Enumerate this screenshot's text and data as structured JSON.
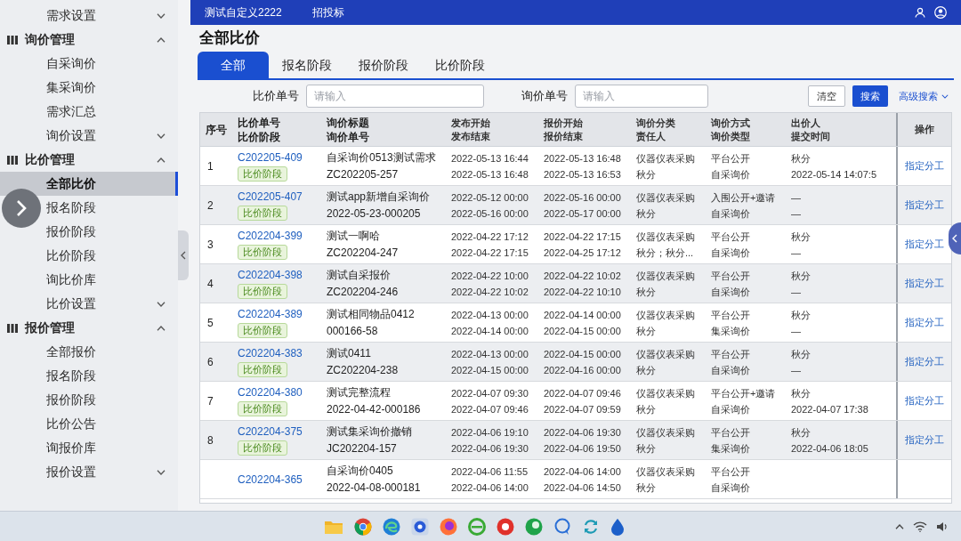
{
  "top_bar": {
    "menu": [
      {
        "label": "测试自定义2222"
      },
      {
        "label": "招投标"
      }
    ]
  },
  "sidebar": {
    "items": [
      {
        "label": "需求设置",
        "kind": "submenu",
        "expanded": false,
        "selected": false
      },
      {
        "label": "询价管理",
        "kind": "group",
        "expanded": true,
        "selected": false,
        "children": [
          {
            "label": "自采询价",
            "kind": "link",
            "selected": false
          },
          {
            "label": "集采询价",
            "kind": "link",
            "selected": false
          },
          {
            "label": "需求汇总",
            "kind": "link",
            "selected": false
          },
          {
            "label": "询价设置",
            "kind": "submenu",
            "expanded": false,
            "selected": false
          }
        ]
      },
      {
        "label": "比价管理",
        "kind": "group",
        "expanded": true,
        "selected": false,
        "children": [
          {
            "label": "全部比价",
            "kind": "link",
            "selected": true
          },
          {
            "label": "报名阶段",
            "kind": "link",
            "selected": false
          },
          {
            "label": "报价阶段",
            "kind": "link",
            "selected": false
          },
          {
            "label": "比价阶段",
            "kind": "link",
            "selected": false
          },
          {
            "label": "询比价库",
            "kind": "link",
            "selected": false
          },
          {
            "label": "比价设置",
            "kind": "submenu",
            "expanded": false,
            "selected": false
          }
        ]
      },
      {
        "label": "报价管理",
        "kind": "group",
        "expanded": true,
        "selected": false,
        "children": [
          {
            "label": "全部报价",
            "kind": "link",
            "selected": false
          },
          {
            "label": "报名阶段",
            "kind": "link",
            "selected": false
          },
          {
            "label": "报价阶段",
            "kind": "link",
            "selected": false
          },
          {
            "label": "比价公告",
            "kind": "link",
            "selected": false
          },
          {
            "label": "询报价库",
            "kind": "link",
            "selected": false
          },
          {
            "label": "报价设置",
            "kind": "submenu",
            "expanded": false,
            "selected": false
          }
        ]
      }
    ]
  },
  "page": {
    "title": "全部比价"
  },
  "tabs": [
    {
      "label": "全部",
      "selected": true
    },
    {
      "label": "报名阶段",
      "selected": false
    },
    {
      "label": "报价阶段",
      "selected": false
    },
    {
      "label": "比价阶段",
      "selected": false
    }
  ],
  "filters": [
    {
      "label": "比价单号",
      "placeholder": "请输入"
    },
    {
      "label": "询价单号",
      "placeholder": "请输入"
    }
  ],
  "buttons": [
    {
      "label": "清空",
      "kind": "secondary"
    },
    {
      "label": "搜索",
      "kind": "primary"
    },
    {
      "label": "高级搜索",
      "kind": "dropdown"
    }
  ],
  "table": {
    "columns": [
      {
        "lines": [
          "序号"
        ]
      },
      {
        "lines": [
          "比价单号",
          "比价阶段"
        ]
      },
      {
        "lines": [
          "询价标题",
          "询价单号"
        ]
      },
      {
        "lines": [
          "发布开始",
          "发布结束"
        ]
      },
      {
        "lines": [
          "报价开始",
          "报价结束"
        ]
      },
      {
        "lines": [
          "询价分类",
          "责任人"
        ]
      },
      {
        "lines": [
          "询价方式",
          "询价类型"
        ]
      },
      {
        "lines": [
          "出价人",
          "提交时间"
        ]
      },
      {
        "lines": [
          "操作"
        ]
      }
    ],
    "rows": [
      {
        "seq": "1",
        "code": "C202205-409",
        "stage": "比价阶段",
        "title": "自采询价0513测试需求",
        "inquiry_no": "ZC202205-257",
        "publish_start": "2022-05-13 16:44",
        "publish_end": "2022-05-13 16:48",
        "quote_start": "2022-05-13 16:48",
        "quote_end": "2022-05-13 16:53",
        "category": "仪器仪表采购",
        "owner": "秋分",
        "method": "平台公开",
        "type": "自采询价",
        "bidder": "秋分",
        "submitted": "2022-05-14 14:07:5",
        "action": "指定分工"
      },
      {
        "seq": "2",
        "code": "C202205-407",
        "stage": "比价阶段",
        "title": "测试app新增自采询价",
        "inquiry_no": "2022-05-23-000205",
        "publish_start": "2022-05-12 00:00",
        "publish_end": "2022-05-16 00:00",
        "quote_start": "2022-05-16 00:00",
        "quote_end": "2022-05-17 00:00",
        "category": "仪器仪表采购",
        "owner": "秋分",
        "method": "入围公开+邀请",
        "type": "自采询价",
        "bidder": "—",
        "submitted": "—",
        "action": "指定分工"
      },
      {
        "seq": "3",
        "code": "C202204-399",
        "stage": "比价阶段",
        "title": "测试一啊哈",
        "inquiry_no": "ZC202204-247",
        "publish_start": "2022-04-22 17:12",
        "publish_end": "2022-04-22 17:15",
        "quote_start": "2022-04-22 17:15",
        "quote_end": "2022-04-25 17:12",
        "category": "仪器仪表采购",
        "owner": "秋分；秋分...",
        "method": "平台公开",
        "type": "自采询价",
        "bidder": "秋分",
        "submitted": "—",
        "action": "指定分工"
      },
      {
        "seq": "4",
        "code": "C202204-398",
        "stage": "比价阶段",
        "title": "测试自采报价",
        "inquiry_no": "ZC202204-246",
        "publish_start": "2022-04-22 10:00",
        "publish_end": "2022-04-22 10:02",
        "quote_start": "2022-04-22 10:02",
        "quote_end": "2022-04-22 10:10",
        "category": "仪器仪表采购",
        "owner": "秋分",
        "method": "平台公开",
        "type": "自采询价",
        "bidder": "秋分",
        "submitted": "—",
        "action": "指定分工"
      },
      {
        "seq": "5",
        "code": "C202204-389",
        "stage": "比价阶段",
        "title": "测试相同物品0412",
        "inquiry_no": "000166-58",
        "publish_start": "2022-04-13 00:00",
        "publish_end": "2022-04-14 00:00",
        "quote_start": "2022-04-14 00:00",
        "quote_end": "2022-04-15 00:00",
        "category": "仪器仪表采购",
        "owner": "秋分",
        "method": "平台公开",
        "type": "集采询价",
        "bidder": "秋分",
        "submitted": "—",
        "action": "指定分工"
      },
      {
        "seq": "6",
        "code": "C202204-383",
        "stage": "比价阶段",
        "title": "测试0411",
        "inquiry_no": "ZC202204-238",
        "publish_start": "2022-04-13 00:00",
        "publish_end": "2022-04-15 00:00",
        "quote_start": "2022-04-15 00:00",
        "quote_end": "2022-04-16 00:00",
        "category": "仪器仪表采购",
        "owner": "秋分",
        "method": "平台公开",
        "type": "自采询价",
        "bidder": "秋分",
        "submitted": "—",
        "action": "指定分工"
      },
      {
        "seq": "7",
        "code": "C202204-380",
        "stage": "比价阶段",
        "title": "测试完整流程",
        "inquiry_no": "2022-04-42-000186",
        "publish_start": "2022-04-07 09:30",
        "publish_end": "2022-04-07 09:46",
        "quote_start": "2022-04-07 09:46",
        "quote_end": "2022-04-07 09:59",
        "category": "仪器仪表采购",
        "owner": "秋分",
        "method": "平台公开+邀请",
        "type": "自采询价",
        "bidder": "秋分",
        "submitted": "2022-04-07 17:38",
        "action": "指定分工"
      },
      {
        "seq": "8",
        "code": "C202204-375",
        "stage": "比价阶段",
        "title": "测试集采询价撤销",
        "inquiry_no": "JC202204-157",
        "publish_start": "2022-04-06 19:10",
        "publish_end": "2022-04-06 19:30",
        "quote_start": "2022-04-06 19:30",
        "quote_end": "2022-04-06 19:50",
        "category": "仪器仪表采购",
        "owner": "秋分",
        "method": "平台公开",
        "type": "集采询价",
        "bidder": "秋分",
        "submitted": "2022-04-06 18:05",
        "action": "指定分工"
      },
      {
        "code": "C202204-365",
        "title": "自采询价0405",
        "inquiry_no": "2022-04-08-000181",
        "publish_start": "2022-04-06 11:55",
        "publish_end": "2022-04-06 14:00",
        "quote_start": "2022-04-06 14:00",
        "quote_end": "2022-04-06 14:50",
        "category": "仪器仪表采购",
        "owner": "秋分",
        "method": "平台公开",
        "type": "自采询价"
      }
    ]
  }
}
